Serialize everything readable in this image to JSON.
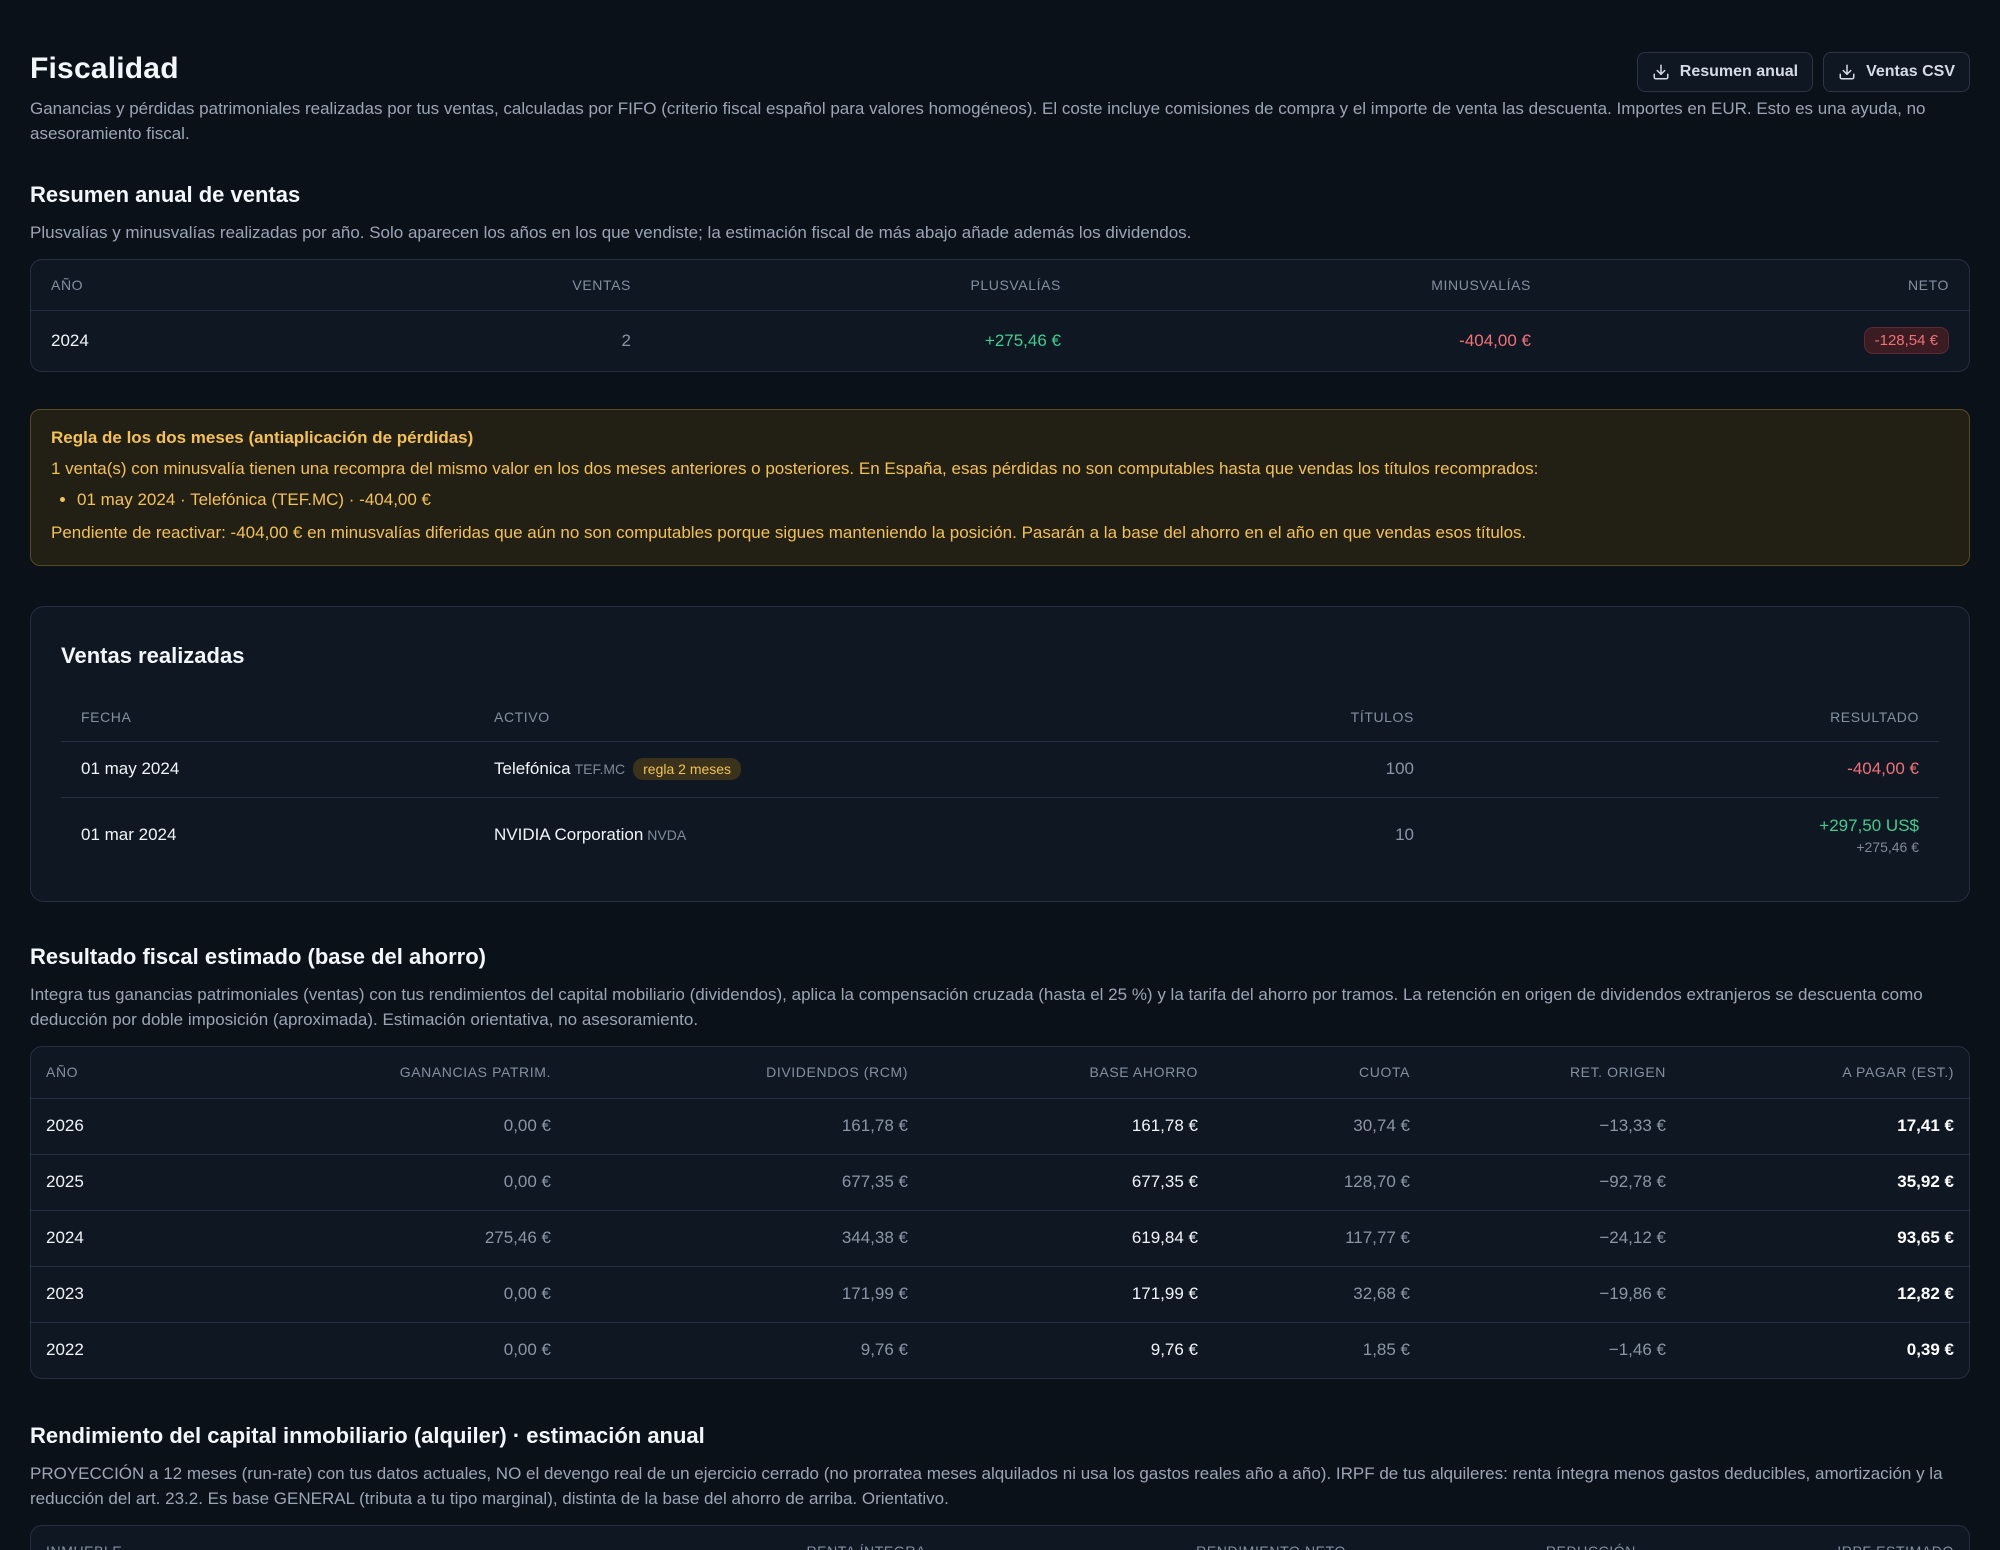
{
  "header": {
    "title": "Fiscalidad",
    "description": "Ganancias y pérdidas patrimoniales realizadas por tus ventas, calculadas por FIFO (criterio fiscal español para valores homogéneos). El coste incluye comisiones de compra y el importe de venta las descuenta. Importes en EUR. Esto es una ayuda, no asesoramiento fiscal.",
    "buttons": [
      {
        "label": "Resumen anual",
        "icon": "download-icon"
      },
      {
        "label": "Ventas CSV",
        "icon": "download-icon"
      }
    ]
  },
  "annual": {
    "title": "Resumen anual de ventas",
    "description": "Plusvalías y minusvalías realizadas por año. Solo aparecen los años en los que vendiste; la estimación fiscal de más abajo añade además los dividendos.",
    "columns": [
      "Año",
      "Ventas",
      "Plusvalías",
      "Minusvalías",
      "Neto"
    ],
    "rows": [
      {
        "year": "2024",
        "sales": "2",
        "gains": "+275,46 €",
        "losses": "-404,00 €",
        "net": "-128,54 €"
      }
    ]
  },
  "warning": {
    "title": "Regla de los dos meses (antiaplicación de pérdidas)",
    "line": "1 venta(s) con minusvalía tienen una recompra del mismo valor en los dos meses anteriores o posteriores. En España, esas pérdidas no son computables hasta que vendas los títulos recomprados:",
    "items": [
      "01 may 2024 · Telefónica (TEF.MC) · -404,00 €"
    ],
    "footer": "Pendiente de reactivar: -404,00 € en minusvalías diferidas que aún no son computables porque sigues manteniendo la posición. Pasarán a la base del ahorro en el año en que vendas esos títulos."
  },
  "sales": {
    "title": "Ventas realizadas",
    "columns": [
      "Fecha",
      "Activo",
      "Títulos",
      "Resultado"
    ],
    "rows": [
      {
        "date": "01 may 2024",
        "asset": "Telefónica",
        "ticker": "TEF.MC",
        "badge": "regla 2 meses",
        "units": "100",
        "result": "-404,00 €",
        "result_eur": ""
      },
      {
        "date": "01 mar 2024",
        "asset": "NVIDIA Corporation",
        "ticker": "NVDA",
        "badge": "",
        "units": "10",
        "result": "+297,50 US$",
        "result_eur": "+275,46 €"
      }
    ]
  },
  "fiscal": {
    "title": "Resultado fiscal estimado (base del ahorro)",
    "description": "Integra tus ganancias patrimoniales (ventas) con tus rendimientos del capital mobiliario (dividendos), aplica la compensación cruzada (hasta el 25 %) y la tarifa del ahorro por tramos. La retención en origen de dividendos extranjeros se descuenta como deducción por doble imposición (aproximada). Estimación orientativa, no asesoramiento.",
    "columns": [
      "Año",
      "Ganancias patrim.",
      "Dividendos (RCM)",
      "Base ahorro",
      "Cuota",
      "Ret. origen",
      "A pagar (est.)"
    ],
    "rows": [
      {
        "year": "2026",
        "gains": "0,00 €",
        "dividends": "161,78 €",
        "base": "161,78 €",
        "quota": "30,74 €",
        "withholding": "−13,33 €",
        "to_pay": "17,41 €"
      },
      {
        "year": "2025",
        "gains": "0,00 €",
        "dividends": "677,35 €",
        "base": "677,35 €",
        "quota": "128,70 €",
        "withholding": "−92,78 €",
        "to_pay": "35,92 €"
      },
      {
        "year": "2024",
        "gains": "275,46 €",
        "dividends": "344,38 €",
        "base": "619,84 €",
        "quota": "117,77 €",
        "withholding": "−24,12 €",
        "to_pay": "93,65 €"
      },
      {
        "year": "2023",
        "gains": "0,00 €",
        "dividends": "171,99 €",
        "base": "171,99 €",
        "quota": "32,68 €",
        "withholding": "−19,86 €",
        "to_pay": "12,82 €"
      },
      {
        "year": "2022",
        "gains": "0,00 €",
        "dividends": "9,76 €",
        "base": "9,76 €",
        "quota": "1,85 €",
        "withholding": "−1,46 €",
        "to_pay": "0,39 €"
      }
    ]
  },
  "realestate": {
    "title": "Rendimiento del capital inmobiliario (alquiler) · estimación anual",
    "description": "PROYECCIÓN a 12 meses (run-rate) con tus datos actuales, NO el devengo real de un ejercicio cerrado (no prorratea meses alquilados ni usa los gastos reales año a año). IRPF de tus alquileres: renta íntegra menos gastos deducibles, amortización y la reducción del art. 23.2. Es base GENERAL (tributa a tu tipo marginal), distinta de la base del ahorro de arriba. Orientativo.",
    "columns": [
      "Inmueble",
      "Renta íntegra",
      "Rendimiento neto",
      "Reducción",
      "IRPF estimado"
    ]
  },
  "colors": {
    "background": "#0b1119",
    "card": "#0f1722",
    "positive": "#3ecf8e",
    "negative": "#f07178",
    "warning": "#f4c24f"
  }
}
